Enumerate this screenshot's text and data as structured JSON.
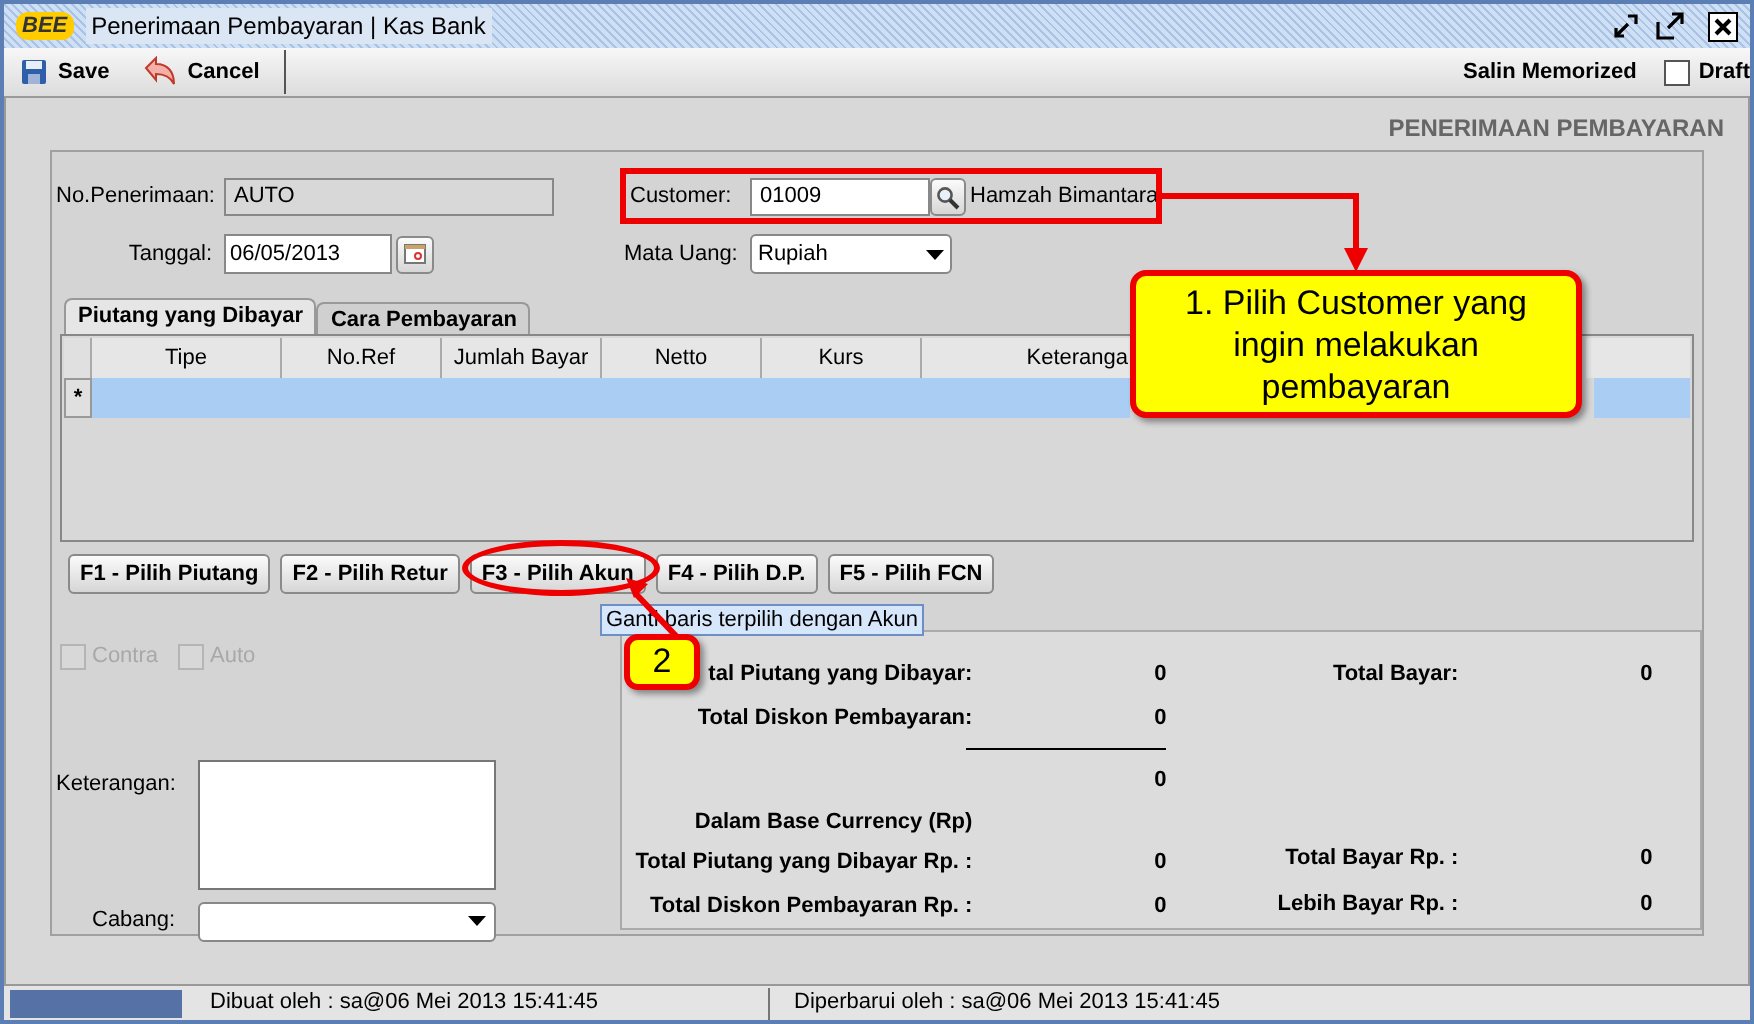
{
  "window": {
    "title": "Penerimaan Pembayaran | Kas Bank",
    "logo": "BEE"
  },
  "toolbar": {
    "buttons": [
      {
        "label": "Save",
        "kind": "save"
      },
      {
        "label": "Cancel",
        "kind": "cancel"
      }
    ],
    "memorized": "Salin Memorized",
    "draft": {
      "label": "Draft",
      "checked": false
    }
  },
  "form_title": "PENERIMAAN PEMBAYARAN",
  "fields": {
    "no_penerimaan": {
      "label": "No.Penerimaan:",
      "value": "AUTO"
    },
    "tanggal": {
      "label": "Tanggal:",
      "value": "06/05/2013"
    },
    "customer": {
      "label": "Customer:",
      "value": "01009",
      "name": "Hamzah Bimantara"
    },
    "mata_uang": {
      "label": "Mata Uang:",
      "value": "Rupiah"
    }
  },
  "tabs": [
    {
      "label": "Piutang yang Dibayar",
      "selected": true
    },
    {
      "label": "Cara Pembayaran",
      "selected": false
    }
  ],
  "table": {
    "columns": [
      "Tipe",
      "No.Ref",
      "Jumlah Bayar",
      "Netto",
      "Kurs",
      "Keteranga"
    ],
    "new_row_marker": "*"
  },
  "buttons": [
    "F1 - Pilih Piutang",
    "F2 - Pilih Retur",
    "F3 - Pilih Akun",
    "F4 - Pilih D.P.",
    "F5 - Pilih FCN"
  ],
  "tooltip": "Ganti baris terpilih dengan Akun",
  "options": [
    {
      "label": "Contra",
      "checked": false,
      "disabled": true
    },
    {
      "label": "Auto",
      "checked": false,
      "disabled": true
    }
  ],
  "keterangan": {
    "label": "Keterangan:"
  },
  "cabang": {
    "label": "Cabang:"
  },
  "totals": {
    "left": [
      {
        "label": "tal Piutang yang Dibayar:",
        "value": "0"
      },
      {
        "label": "Total Diskon Pembayaran:",
        "value": "0"
      }
    ],
    "subtotal": "0",
    "right": [
      {
        "label": "Total Bayar:",
        "value": "0"
      }
    ],
    "base_heading": "Dalam Base Currency (Rp)",
    "base_left": [
      {
        "label": "Total Piutang yang Dibayar Rp. :",
        "value": "0"
      },
      {
        "label": "Total Diskon Pembayaran Rp. :",
        "value": "0"
      }
    ],
    "base_right": [
      {
        "label": "Total Bayar Rp. :",
        "value": "0"
      },
      {
        "label": "Lebih Bayar Rp. :",
        "value": "0"
      }
    ]
  },
  "status_bar": [
    "Dibuat oleh : sa@06 Mei 2013  15:41:45",
    "Diperbarui oleh : sa@06 Mei 2013  15:41:45"
  ],
  "annotations": [
    {
      "kind": "callout",
      "text": "1. Pilih Customer yang ingin melakukan pembayaran"
    },
    {
      "kind": "badge",
      "text": "2"
    }
  ]
}
